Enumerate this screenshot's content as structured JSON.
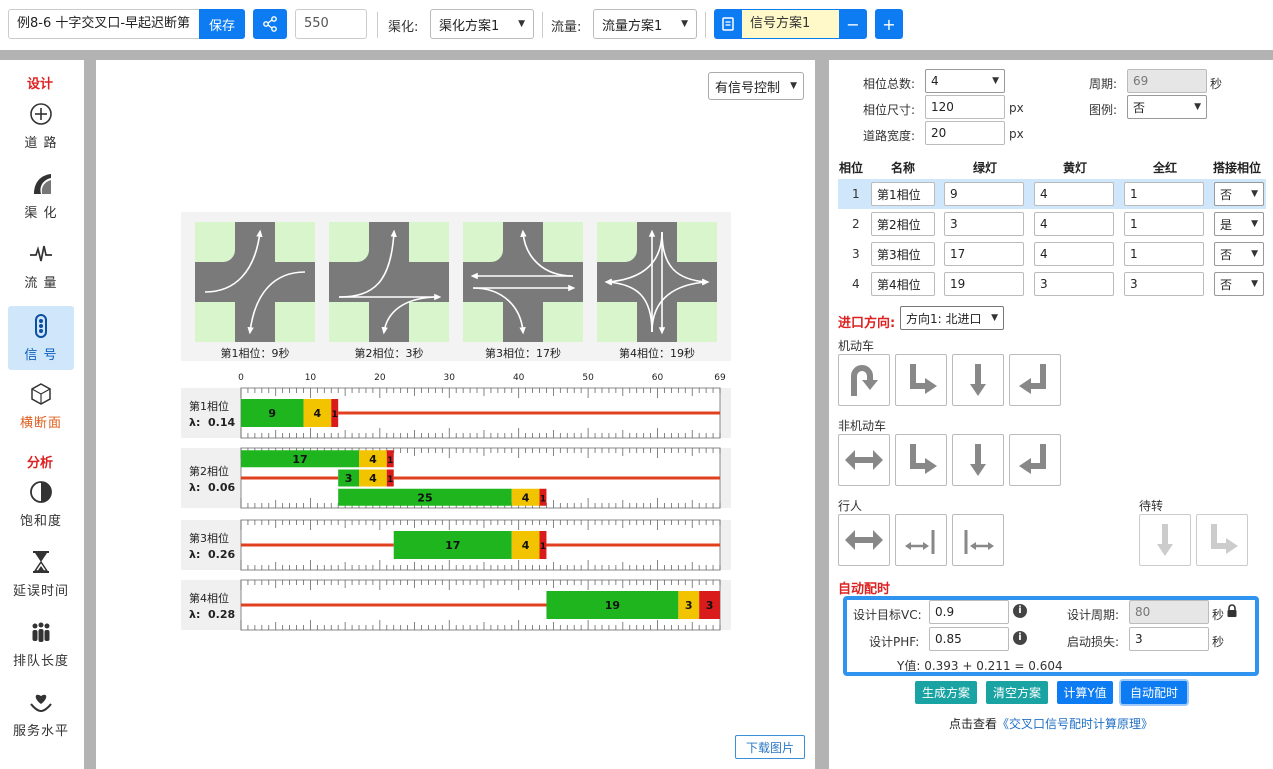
{
  "toolbar": {
    "project_name": "例8-6 十字交叉口-早起迟断第",
    "save_label": "保存",
    "value_550": "550",
    "channel_label": "渠化:",
    "channel_plan": "渠化方案1",
    "flow_label": "流量:",
    "flow_plan": "流量方案1",
    "signal_plan": "信号方案1",
    "minus": "−",
    "plus": "+"
  },
  "sidebar": {
    "section_design": "设计",
    "section_analysis": "分析",
    "items": [
      {
        "label": "道 路",
        "icon": "compass-icon"
      },
      {
        "label": "渠 化",
        "icon": "channel-icon"
      },
      {
        "label": "流 量",
        "icon": "pulse-icon"
      },
      {
        "label": "信 号",
        "icon": "traffic-light-icon"
      },
      {
        "label": "横断面",
        "icon": "cube-icon"
      },
      {
        "label": "饱和度",
        "icon": "half-circle-icon"
      },
      {
        "label": "延误时间",
        "icon": "hourglass-icon"
      },
      {
        "label": "排队长度",
        "icon": "people-icon"
      },
      {
        "label": "服务水平",
        "icon": "heart-hand-icon"
      }
    ]
  },
  "canvas": {
    "control_select": "有信号控制",
    "download_label": "下载图片",
    "phases": [
      {
        "caption": "第1相位：9秒"
      },
      {
        "caption": "第2相位：3秒"
      },
      {
        "caption": "第3相位：17秒"
      },
      {
        "caption": "第4相位：19秒"
      }
    ]
  },
  "chart_data": {
    "type": "table",
    "title": "",
    "axis_ticks": [
      0,
      10,
      20,
      30,
      40,
      50,
      60,
      69
    ],
    "xlim": [
      0,
      69
    ],
    "cycle": 69,
    "colors": {
      "green": "#1fb51f",
      "yellow": "#f2c400",
      "red": "#d91b1b",
      "redline": "#e0401e"
    },
    "rows": [
      {
        "label": "第1相位",
        "lambda_label": "λ: ",
        "lambda": "0.14",
        "bars": [
          [
            {
              "start": 0,
              "green": 9,
              "yellow": 4,
              "red": 1
            }
          ]
        ]
      },
      {
        "label": "第2相位",
        "lambda_label": "λ: ",
        "lambda": "0.06",
        "bars": [
          [
            {
              "start": 0,
              "green": 17,
              "yellow": 4,
              "red": 1
            }
          ],
          [
            {
              "start": 14,
              "green": 3,
              "yellow": 4,
              "red": 1
            }
          ],
          [
            {
              "start": 14,
              "green": 25,
              "yellow": 4,
              "red": 1
            }
          ]
        ]
      },
      {
        "label": "第3相位",
        "lambda_label": "λ: ",
        "lambda": "0.26",
        "bars": [
          [
            {
              "start": 22,
              "green": 17,
              "yellow": 4,
              "red": 1
            }
          ]
        ]
      },
      {
        "label": "第4相位",
        "lambda_label": "λ: ",
        "lambda": "0.28",
        "bars": [
          [
            {
              "start": 44,
              "green": 19,
              "yellow": 3,
              "red": 3
            }
          ]
        ]
      }
    ]
  },
  "settings": {
    "phase_total_label": "相位总数:",
    "phase_total": "4",
    "cycle_label": "周期:",
    "cycle_value": "69",
    "cycle_unit": "秒",
    "phase_size_label": "相位尺寸:",
    "phase_size": "120",
    "px1": "px",
    "legend_label": "图例:",
    "legend_value": "否",
    "road_width_label": "道路宽度:",
    "road_width": "20",
    "px2": "px"
  },
  "phase_table": {
    "headers": [
      "相位",
      "名称",
      "绿灯",
      "黄灯",
      "全红",
      "搭接相位"
    ],
    "rows": [
      {
        "idx": "1",
        "name": "第1相位",
        "green": "9",
        "yellow": "4",
        "red": "1",
        "overlap": "否"
      },
      {
        "idx": "2",
        "name": "第2相位",
        "green": "3",
        "yellow": "4",
        "red": "1",
        "overlap": "是"
      },
      {
        "idx": "3",
        "name": "第3相位",
        "green": "17",
        "yellow": "4",
        "red": "1",
        "overlap": "否"
      },
      {
        "idx": "4",
        "name": "第4相位",
        "green": "19",
        "yellow": "3",
        "red": "3",
        "overlap": "否"
      }
    ]
  },
  "approach": {
    "label": "进口方向:",
    "value": "方向1: 北进口",
    "motor_label": "机动车",
    "nonmotor_label": "非机动车",
    "ped_label": "行人",
    "wait_label": "待转"
  },
  "auto": {
    "title": "自动配时",
    "target_vc_label": "设计目标VC:",
    "target_vc": "0.9",
    "design_cycle_label": "设计周期:",
    "design_cycle": "80",
    "sec1": "秒",
    "phf_label": "设计PHF:",
    "phf": "0.85",
    "startup_label": "启动损失:",
    "startup": "3",
    "sec2": "秒",
    "y_text": "Y值: 0.393 + 0.211 = 0.604",
    "btn_generate": "生成方案",
    "btn_clear": "清空方案",
    "btn_calc": "计算Y值",
    "btn_auto": "自动配时",
    "link_prefix": "点击查看",
    "link_text": "《交叉口信号配时计算原理》"
  }
}
